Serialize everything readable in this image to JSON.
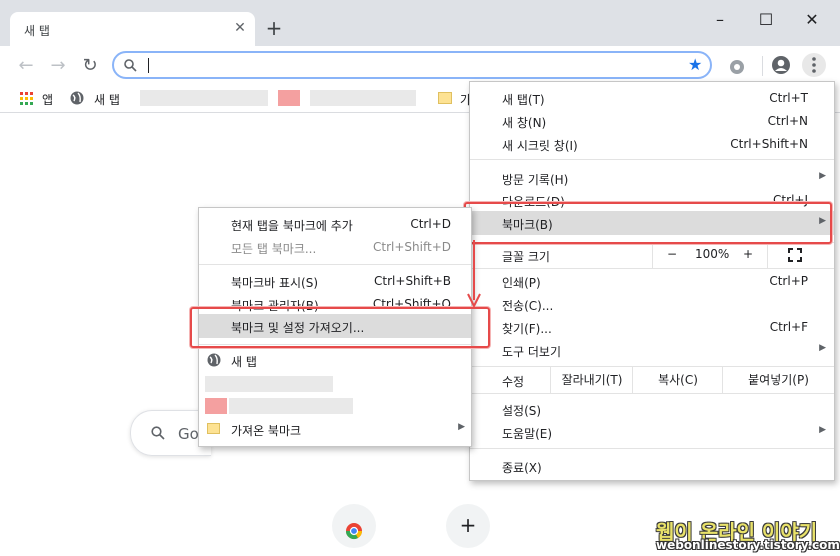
{
  "tab": {
    "title": "새 탭",
    "close": "✕",
    "new_tab": "+"
  },
  "window": {
    "minimize": "–",
    "maximize": "☐",
    "close": "✕"
  },
  "toolbar": {
    "back": "←",
    "forward": "→",
    "reload": "↻",
    "search_glyph": "🔍",
    "star": "★"
  },
  "bookmarks_bar": {
    "apps_label": "앱",
    "newtab_label": "새 탭",
    "folder_label": "가"
  },
  "main_menu": {
    "new_tab": "새 탭(T)",
    "new_tab_sc": "Ctrl+T",
    "new_window": "새 창(N)",
    "new_window_sc": "Ctrl+N",
    "incognito": "새 시크릿 창(I)",
    "incognito_sc": "Ctrl+Shift+N",
    "history": "방문 기록(H)",
    "downloads": "다운로드(D)",
    "downloads_sc": "Ctrl+J",
    "bookmarks": "북마크(B)",
    "zoom_label": "글꼴 크기",
    "zoom_minus": "−",
    "zoom_value": "100%",
    "zoom_plus": "+",
    "print": "인쇄(P)",
    "print_sc": "Ctrl+P",
    "cast": "전송(C)...",
    "find": "찾기(F)...",
    "find_sc": "Ctrl+F",
    "more_tools": "도구 더보기",
    "edit": "수정",
    "cut": "잘라내기(T)",
    "copy": "복사(C)",
    "paste": "붙여넣기(P)",
    "settings": "설정(S)",
    "help": "도움말(E)",
    "exit": "종료(X)"
  },
  "bookmark_submenu": {
    "bookmark_page": "현재 탭을 북마크에 추가",
    "bookmark_page_sc": "Ctrl+D",
    "bookmark_all": "모든 탭 북마크...",
    "bookmark_all_sc": "Ctrl+Shift+D",
    "show_bar": "북마크바 표시(S)",
    "show_bar_sc": "Ctrl+Shift+B",
    "manager": "북마크 관리자(B)",
    "manager_sc": "Ctrl+Shift+O",
    "import": "북마크 및 설정 가져오기...",
    "newtab": "새 탭",
    "imported": "가져온 북마크"
  },
  "ntp": {
    "search_placeholder": "Go"
  },
  "watermark": {
    "line1": "웹이 온라인 이야기",
    "line2": "webonlinestory.tistory.com"
  },
  "colors": {
    "highlight_border": "#e64a4a",
    "star": "#1a73e8"
  }
}
